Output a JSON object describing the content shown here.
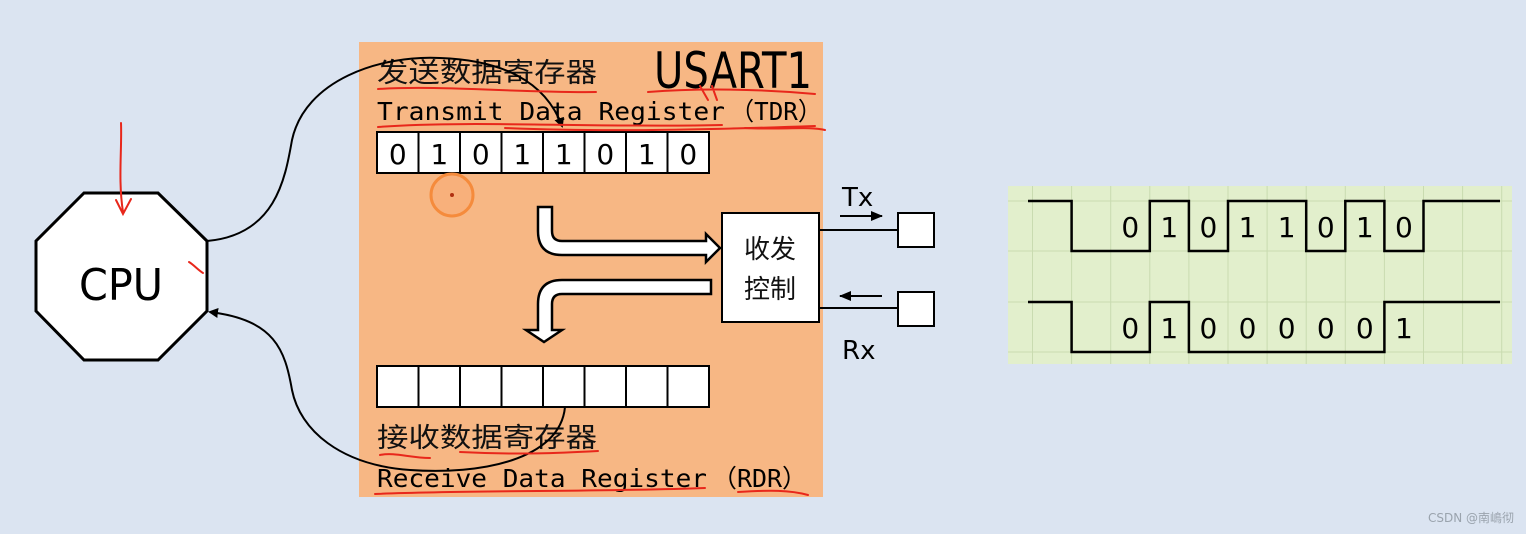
{
  "diagram": {
    "cpu": {
      "label": "CPU"
    },
    "usart": {
      "title": "USART1",
      "tdr": {
        "label_cn": "发送数据寄存器",
        "label_en": "Transmit Data Register",
        "abbr": "（TDR）",
        "bits": [
          "0",
          "1",
          "0",
          "1",
          "1",
          "0",
          "1",
          "0"
        ]
      },
      "rdr": {
        "label_cn": "接收数据寄存器",
        "label_en": "Receive Data Register",
        "abbr": "（RDR）",
        "bits": [
          "",
          "",
          "",
          "",
          "",
          "",
          "",
          ""
        ]
      },
      "control": {
        "line1": "收发",
        "line2": "控制"
      },
      "tx_label": "Tx",
      "rx_label": "Rx"
    },
    "waveforms": [
      {
        "name": "tx-waveform",
        "bits": [
          "0",
          "1",
          "0",
          "1",
          "1",
          "0",
          "1",
          "0"
        ]
      },
      {
        "name": "rx-waveform",
        "bits": [
          "0",
          "1",
          "0",
          "0",
          "0",
          "0",
          "0",
          "1"
        ]
      }
    ],
    "colors": {
      "background": "#dbe4f1",
      "usart_panel": "#f7b784",
      "wave_panel": "#e2efcc",
      "annotation": "#e8271b",
      "cursor": "#f58b3c"
    }
  },
  "watermark": "CSDN @南嶋彻"
}
